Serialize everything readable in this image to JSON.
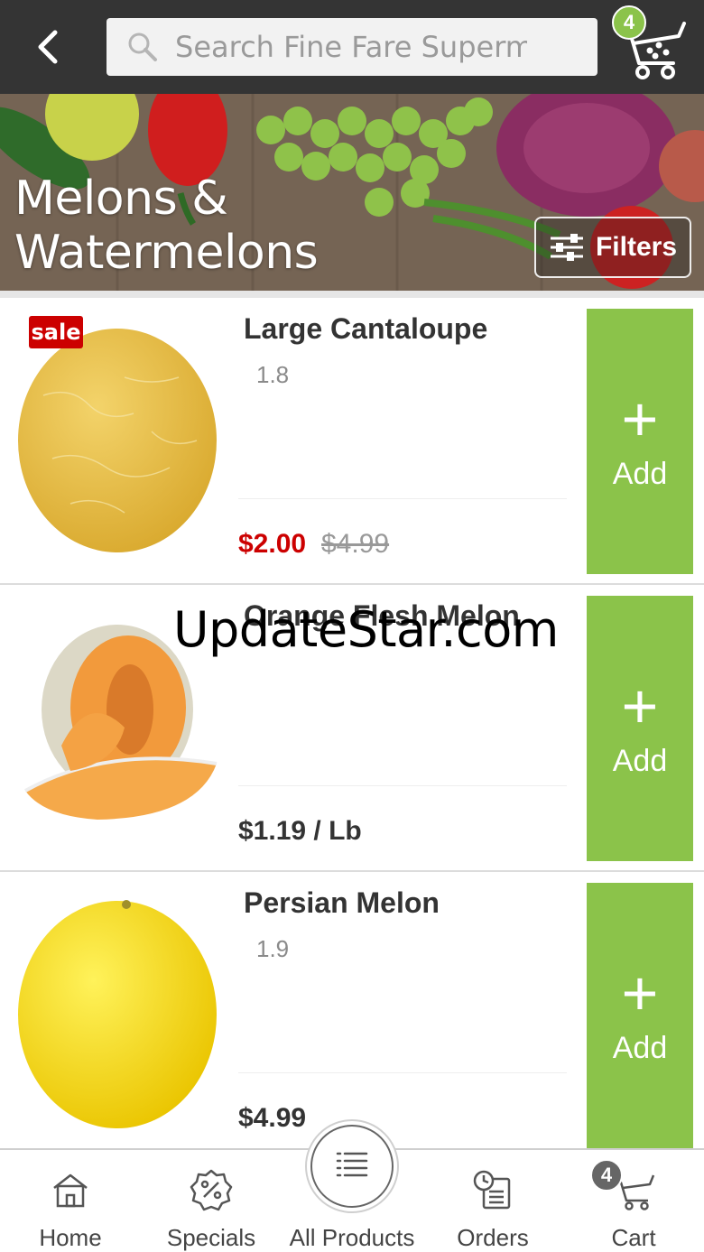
{
  "header": {
    "search_placeholder": "Search Fine Fare Supermarket",
    "cart_count": "4"
  },
  "banner": {
    "title_line1": "Melons &",
    "title_line2": "Watermelons",
    "filters_label": "Filters"
  },
  "products": [
    {
      "name": "Large Cantaloupe",
      "rating": "1.8",
      "price": "$2.00",
      "old_price": "$4.99",
      "sale_label": "sale",
      "add_label": "Add"
    },
    {
      "name": "Orange Flesh Melon",
      "rating": "",
      "price": "$1.19 / Lb",
      "add_label": "Add"
    },
    {
      "name": "Persian Melon",
      "rating": "1.9",
      "price": "$4.99",
      "add_label": "Add"
    }
  ],
  "watermark": "UpdateStar.com",
  "bottom_nav": {
    "items": [
      {
        "label": "Home",
        "icon": "home-icon"
      },
      {
        "label": "Specials",
        "icon": "percent-badge-icon"
      },
      {
        "label": "All Products",
        "icon": "list-icon"
      },
      {
        "label": "Orders",
        "icon": "orders-clock-icon"
      },
      {
        "label": "Cart",
        "icon": "cart-icon"
      }
    ],
    "cart_count": "4"
  },
  "colors": {
    "header_bg": "#343434",
    "accent_green": "#8bc34a",
    "sale_red": "#cc0000"
  }
}
